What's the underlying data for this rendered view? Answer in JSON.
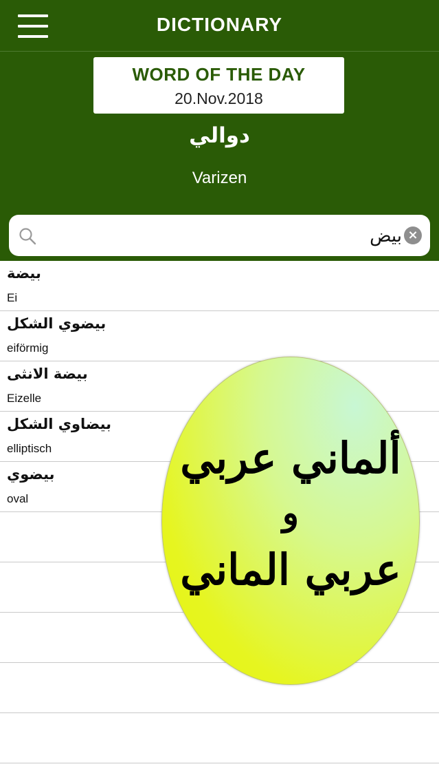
{
  "header": {
    "title": "DICTIONARY",
    "menu_icon": "hamburger-menu-icon"
  },
  "word_of_the_day": {
    "heading": "WORD OF THE DAY",
    "date": "20.Nov.2018",
    "arabic": "دوالي",
    "german": "Varizen"
  },
  "search": {
    "value": "بيض",
    "placeholder": "",
    "search_icon": "magnifier-icon",
    "clear_icon": "clear-x-icon"
  },
  "results": [
    {
      "arabic": "بيضة",
      "german": "Ei"
    },
    {
      "arabic": "بيضوي الشكل",
      "german": "eiförmig"
    },
    {
      "arabic": "بيضة الانثى",
      "german": "Eizelle"
    },
    {
      "arabic": "بيضاوي الشكل",
      "german": "elliptisch"
    },
    {
      "arabic": "بيضوي",
      "german": "oval"
    }
  ],
  "promo_badge": {
    "line1": "ألماني عربي",
    "line2": "و",
    "line3": "عربي الماني"
  },
  "colors": {
    "header_green": "#2a5b06",
    "badge_yellow": "#e8f40e"
  }
}
